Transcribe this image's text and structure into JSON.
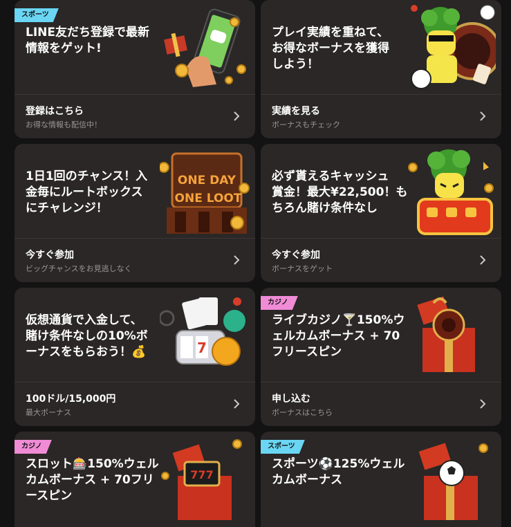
{
  "cards": [
    {
      "tag": "スポーツ",
      "title": "LINE友だち登録で最新\n情報をゲット!",
      "cta": "登録はこちら",
      "sub": "お得な情報も配信中！"
    },
    {
      "tag": "",
      "title": "プレイ実績を重ねて、\nお得なボーナスを獲得\nしよう！",
      "cta": "実績を見る",
      "sub": "ボーナスもチェック"
    },
    {
      "tag": "",
      "title": "1日1回のチャンス！入\n金毎にルートボックス\nにチャレンジ！",
      "cta": "今すぐ参加",
      "sub": "ビッグチャンスをお見逃しなく",
      "art_text": [
        "ONE DAY",
        "ONE LOOT"
      ]
    },
    {
      "tag": "",
      "title": "必ず貰えるキャッシュ\n賞金！最大¥22,500！も\nちろん賭け条件なし",
      "cta": "今すぐ参加",
      "sub": "ボーナスをゲット"
    },
    {
      "tag": "",
      "title": "仮想通貨で入金して、\n賭け条件なしの10%ボ\nーナスをもらおう！💰",
      "cta": "100ドル/15,000円",
      "sub": "最大ボーナス"
    },
    {
      "tag": "カジノ",
      "title": "ライブカジノ🍸150%ウ\nェルカムボーナス + 70\nフリースピン",
      "cta": "申し込む",
      "sub": "ボーナスはこちら"
    },
    {
      "tag": "カジノ",
      "title": "スロット🎰150%ウェル\nカムボーナス + 70フリ\nースピン",
      "cta": "",
      "sub": ""
    },
    {
      "tag": "スポーツ",
      "title": "スポーツ⚽125%ウェル\nカムボーナス",
      "cta": "",
      "sub": ""
    }
  ],
  "icons": {
    "chevron": "chevron-right-icon"
  },
  "colors": {
    "card_bg": "#2a2726",
    "page_bg": "#131313",
    "sports_tag": "#6ad6f3",
    "casino_tag": "#f08bd6",
    "sub_text": "#9a9694"
  }
}
